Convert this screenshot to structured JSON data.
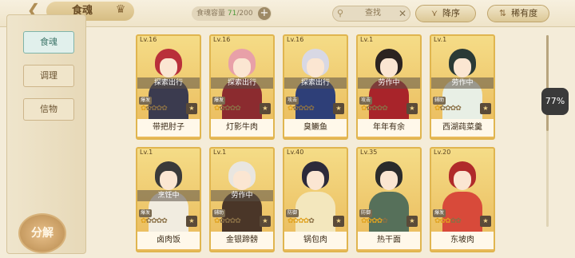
{
  "header": {
    "back_icon": "back-chevron-icon",
    "title": "食魂",
    "crown_icon": "crown-icon",
    "capacity_label": "食魂容量",
    "capacity_current": "71",
    "capacity_max": "/200",
    "add_symbol": "+",
    "search_placeholder": "查找",
    "search_clear": "✕",
    "sort_order_label": "降序",
    "sort_rarity_label": "稀有度"
  },
  "sidebar": {
    "tabs": [
      "食魂",
      "调理",
      "信物"
    ],
    "active_tab": "食魂",
    "decompose_label": "分解"
  },
  "cards": [
    {
      "level": "Lv.16",
      "name": "带把肘子",
      "status": "探索出行",
      "element": "爆发",
      "stars_lit": 1,
      "hair": "#b9303a",
      "body": "#3b3b4f"
    },
    {
      "level": "Lv.16",
      "name": "灯影牛肉",
      "status": "探索出行",
      "element": "爆发",
      "stars_lit": 1,
      "hair": "#e8a0a8",
      "body": "#8b2b2f"
    },
    {
      "level": "Lv.16",
      "name": "臭鳜鱼",
      "status": "探索出行",
      "element": "攻击",
      "stars_lit": 1,
      "hair": "#d8d8e4",
      "body": "#2e3f78"
    },
    {
      "level": "Lv.1",
      "name": "年年有余",
      "status": "劳作中",
      "element": "攻击",
      "stars_lit": 1,
      "hair": "#2b2320",
      "body": "#a8242a"
    },
    {
      "level": "Lv.1",
      "name": "西湖莼菜羹",
      "status": "劳作中",
      "element": "辅助",
      "stars_lit": 1,
      "hair": "#2a3a36",
      "body": "#e8efe5"
    },
    {
      "level": "Lv.1",
      "name": "卤肉饭",
      "status": "烹饪中",
      "element": "爆发",
      "stars_lit": 1,
      "hair": "#3a3a3a",
      "body": "#f1ece0"
    },
    {
      "level": "Lv.1",
      "name": "金银蹄髈",
      "status": "劳作中",
      "element": "辅助",
      "stars_lit": 1,
      "hair": "#e9e6e0",
      "body": "#4a3628"
    },
    {
      "level": "Lv.40",
      "name": "锅包肉",
      "status": "",
      "element": "防御",
      "stars_lit": 4,
      "hair": "#2c2a3a",
      "body": "#f3e7bd"
    },
    {
      "level": "Lv.35",
      "name": "热干面",
      "status": "",
      "element": "防御",
      "stars_lit": 4,
      "hair": "#2b2b2b",
      "body": "#56705a"
    },
    {
      "level": "Lv.20",
      "name": "东坡肉",
      "status": "",
      "element": "爆发",
      "stars_lit": 3,
      "hair": "#b02a2a",
      "body": "#d84a3a"
    }
  ],
  "zoom": "77%"
}
